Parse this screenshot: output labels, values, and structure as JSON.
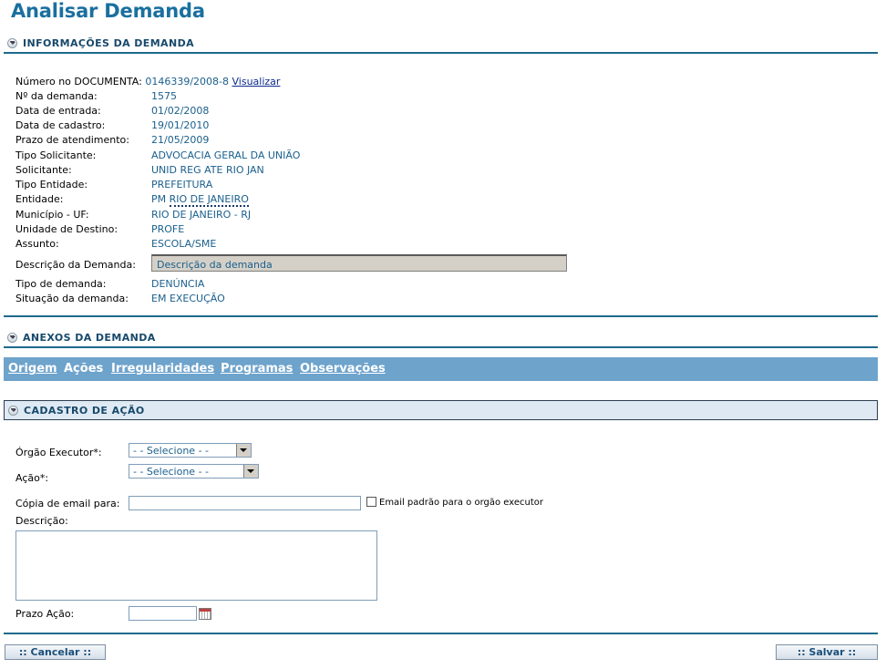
{
  "page": {
    "title": "Analisar Demanda"
  },
  "sections": {
    "info": "INFORMAÇÕES DA DEMANDA",
    "anexos": "ANEXOS DA DEMANDA",
    "cadastro": "CADASTRO DE AÇÃO"
  },
  "info": {
    "numero_documento_label": "Número no DOCUMENTA:",
    "numero_documento_value": "0146339/2008-8",
    "visualizar_link": "Visualizar",
    "rows": [
      {
        "label": "Nº da demanda:",
        "value": "1575"
      },
      {
        "label": "Data de entrada:",
        "value": "01/02/2008"
      },
      {
        "label": "Data de cadastro:",
        "value": "19/01/2010"
      },
      {
        "label": "Prazo de atendimento:",
        "value": "21/05/2009"
      },
      {
        "label": "Tipo Solicitante:",
        "value": "ADVOCACIA GERAL DA UNIÃO"
      },
      {
        "label": "Solicitante:",
        "value": "UNID REG ATE RIO JAN"
      },
      {
        "label": "Tipo Entidade:",
        "value": "PREFEITURA"
      }
    ],
    "entidade_label": "Entidade:",
    "entidade_prefix": "PM",
    "entidade_link": "RIO DE JANEIRO",
    "rows2": [
      {
        "label": "Município - UF:",
        "value": "RIO DE JANEIRO - RJ"
      },
      {
        "label": "Unidade de Destino:",
        "value": "PROFE"
      },
      {
        "label": "Assunto:",
        "value": "ESCOLA/SME"
      }
    ],
    "descricao_label": "Descrição da Demanda:",
    "descricao_value": "Descrição da demanda",
    "rows3": [
      {
        "label": "Tipo de demanda:",
        "value": "DENÚNCIA"
      },
      {
        "label": "Situação da demanda:",
        "value": "EM EXECUÇÃO"
      }
    ]
  },
  "tabs": [
    {
      "label": "Origem",
      "link": true
    },
    {
      "label": "Ações",
      "link": false
    },
    {
      "label": "Irregularidades",
      "link": true
    },
    {
      "label": "Programas",
      "link": true
    },
    {
      "label": "Observações",
      "link": true
    }
  ],
  "form": {
    "orgao_label": "Órgão Executor*:",
    "orgao_selected": "- - Selecione - -",
    "acao_label": "Ação*:",
    "acao_selected": "- - Selecione - -",
    "copia_label": "Cópia de email para:",
    "copia_value": "",
    "email_padrao_label": "Email padrão para o orgão executor",
    "descricao_label": "Descrição:",
    "descricao_value": "",
    "prazo_label": "Prazo Ação:",
    "prazo_value": ""
  },
  "footer": {
    "cancel_label": ":: Cancelar ::",
    "save_label": ":: Salvar ::"
  },
  "colors": {
    "accent": "#1e6a8c",
    "tabbar": "#6ea3cc",
    "header_bg": "#dfe9f3",
    "value_text": "#1a5f8c"
  }
}
